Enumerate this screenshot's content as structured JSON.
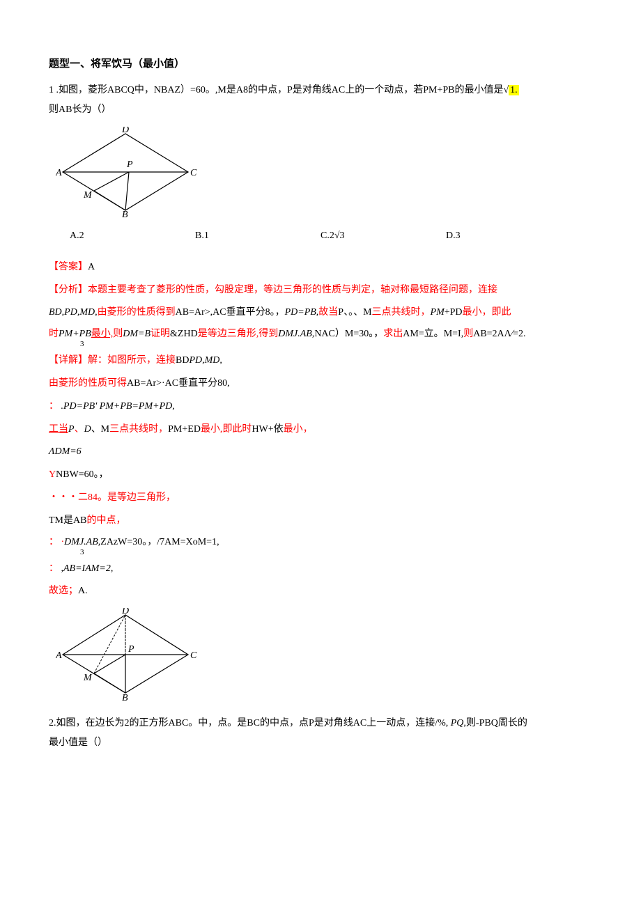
{
  "heading": "题型一、将军饮马（最小值）",
  "q1": {
    "num": "1",
    "text_a": " .如图，菱形ABCQ中，NBAZ）=60。,M是A8的中点，P是对角线AC上的一个动点，若PM+PB的最小值是√",
    "highlight": "1.",
    "text_b": "则AB长为（）",
    "choices": {
      "a": "A.2",
      "b": "B.1",
      "c": "C.2√3",
      "d": "D.3"
    }
  },
  "sol": {
    "ans_label": "【答案】",
    "ans_val": "A",
    "fx_label": "【分析】",
    "fx_text": "本题主要考查了菱形的性质，勾股定理，等边三角形的性质与判定，轴对称最短路径问题，连接",
    "line2a": "BD,PD,MD,",
    "line2b": "由菱形的性质得到",
    "line2c": "AB=Ar>,AC垂直平分8。，",
    "line2d": "PD=PB,",
    "line2e": "故当",
    "line2f": "P、。、M",
    "line2g": "三点共线时，",
    "line2h": "PM",
    "line2i": "+PD",
    "line2i2": "最小，即此",
    "line3a": "时",
    "line3b": "PM+PB",
    "line3c": "最小,",
    "line3d": "则",
    "line3e": "DM=B",
    "line3f": "证明",
    "line3g": "&ZHD",
    "line3h": "是等边三角形,",
    "line3i": "得到",
    "line3j": "DMJ.AB,",
    "line3k": "NAC）M=30。，",
    "line3l": "求出",
    "line3m": "AM=立。",
    "line3n": "M=I,",
    "line3o": "则",
    "line3p": "AB=2AΛ∕=2.",
    "frac3": "3",
    "xj_label": "【详解】",
    "xj_a": "解：如图所示，连接",
    "xj_b": "BD",
    "xj_c": "PD,MD,",
    "l5a": "由菱形的性质可得",
    "l5b": "AB=Ar>·AC垂直平分",
    "l5c": "80,",
    "l6a": "：",
    "l6b": ".PD=PB'        PM+PB=PM+PD,",
    "l7a": "工当",
    "l7b": "P",
    "l7c": "、",
    "l7d": "D",
    "l7e": "、M",
    "l7f": "三点共线时，",
    "l7g": "PM+ED",
    "l7h": "最小,",
    "l7i": "即此时",
    "l7j": "HW+依",
    "l7k": "最小，",
    "l8": "ΛDM=6",
    "l9a": "Y",
    "l9b": "NBW=60。，",
    "l10a": "・・・二84。是",
    "l10b": "等边三角形，",
    "l11a": "TM是",
    "l11b": "AB",
    "l11c": "的中点，",
    "l12a": "：  ·",
    "l12b": "DMJ.AB,",
    "l12c": "ZAzW=30。，",
    "l12d": "/7AM=XoM=1,",
    "l12frac": "3",
    "l13a": "：",
    "l13b": ",AB=IAM=2,",
    "l14a": "故选；",
    "l14b": "A."
  },
  "q2": {
    "num": "2.",
    "text_a": "如图，在边长为2的正方形ABC。中，点。是BC的中点，点P是对角线AC上一动点，连接/%, ",
    "text_b": "PQ,",
    "text_c": "则-PBQ周长的",
    "text_d": "最小值是（）"
  },
  "diagram_labels": {
    "D": "D",
    "A": "A",
    "C": "C",
    "P": "P",
    "M": "M",
    "B": "B"
  }
}
